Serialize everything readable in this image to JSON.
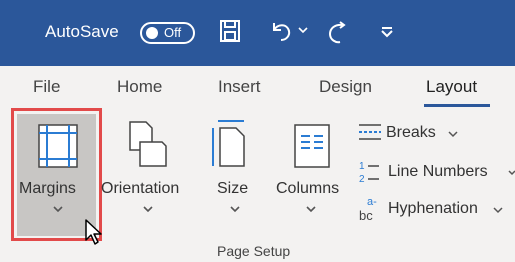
{
  "titlebar": {
    "autosave_label": "AutoSave",
    "toggle_text": "Off",
    "icons": [
      "save-icon",
      "undo-icon",
      "redo-icon",
      "customize-qat-icon"
    ],
    "color": "#2b579a"
  },
  "tabs": [
    {
      "label": "File"
    },
    {
      "label": "Home"
    },
    {
      "label": "Insert"
    },
    {
      "label": "Design"
    },
    {
      "label": "Layout",
      "active": true
    }
  ],
  "ribbon": {
    "group_label": "Page Setup",
    "buttons": {
      "margins": "Margins",
      "orientation": "Orientation",
      "size": "Size",
      "columns": "Columns"
    },
    "stack": {
      "breaks": "Breaks",
      "line_numbers": "Line Numbers",
      "hyphenation": "Hyphenation"
    },
    "highlight_color": "#e24a4a"
  }
}
